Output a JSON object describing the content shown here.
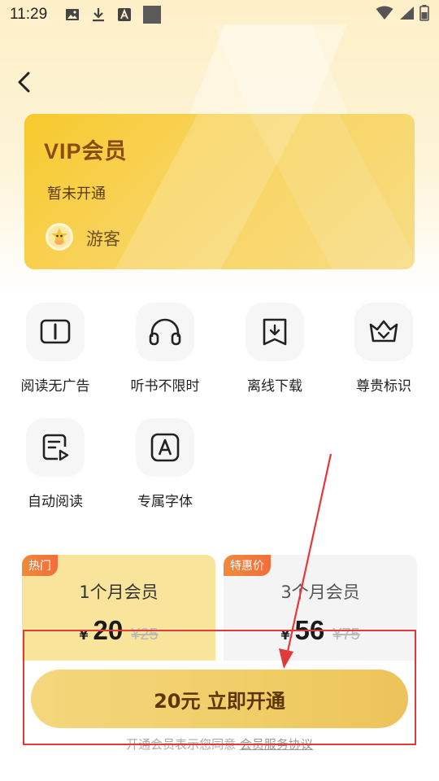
{
  "status_bar": {
    "time": "11:29"
  },
  "header": {
    "back_icon": "chevron-left-icon"
  },
  "vip_card": {
    "title": "VIP会员",
    "status": "暂未开通",
    "user_name": "游客"
  },
  "features": [
    {
      "label": "阅读无广告",
      "icon": "book-open-icon"
    },
    {
      "label": "听书不限时",
      "icon": "headphones-icon"
    },
    {
      "label": "离线下载",
      "icon": "download-bookmark-icon"
    },
    {
      "label": "尊贵标识",
      "icon": "crown-icon"
    },
    {
      "label": "自动阅读",
      "icon": "auto-read-icon"
    },
    {
      "label": "专属字体",
      "icon": "font-icon"
    }
  ],
  "plans": [
    {
      "badge": "热门",
      "name": "1个月会员",
      "currency": "¥",
      "price": "20",
      "original_price": "¥25",
      "selected": true
    },
    {
      "badge": "特惠价",
      "name": "3个月会员",
      "currency": "¥",
      "price": "56",
      "original_price": "¥75",
      "selected": false
    }
  ],
  "purchase": {
    "button_label": "20元 立即开通",
    "agreement_text": "开通会员表示您同意",
    "agreement_link": "会员服务协议"
  },
  "colors": {
    "accent_gold": "#f7c92c",
    "annotation_red": "#e03a3a",
    "badge_orange": "#f26e3a"
  }
}
